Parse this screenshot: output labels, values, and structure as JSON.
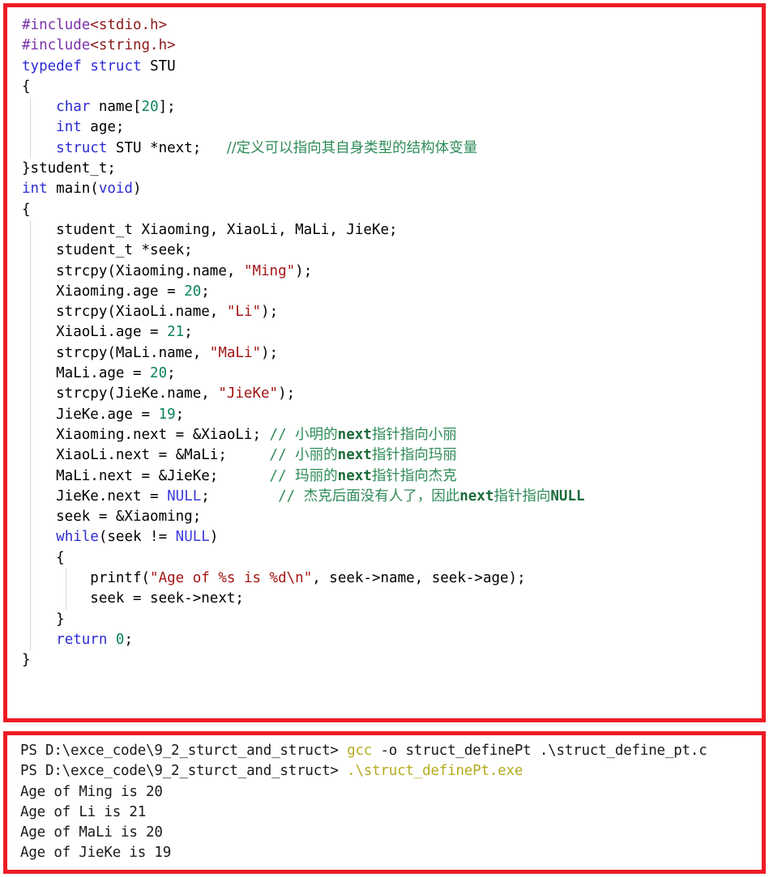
{
  "colors": {
    "border_red": "#ee1c25",
    "keyword_blue": "#2c2cd4",
    "preprocessor_purple": "#7b32a8",
    "header_darkred": "#8b1a1a",
    "string_red": "#a31515",
    "number_green": "#0b8457",
    "comment_green": "#2e8b57",
    "null_blue": "#3b3bdd",
    "terminal_command_olive": "#b5ab20",
    "background": "#ffffff",
    "text_black": "#000000"
  },
  "code_panel": {
    "language": "c",
    "lines": [
      {
        "n": 1,
        "tokens": [
          {
            "t": "#include",
            "c": "pre"
          },
          {
            "t": "<stdio.h>",
            "c": "hdr"
          }
        ]
      },
      {
        "n": 2,
        "tokens": [
          {
            "t": "#include",
            "c": "pre"
          },
          {
            "t": "<string.h>",
            "c": "hdr"
          }
        ]
      },
      {
        "n": 3,
        "tokens": [
          {
            "t": "typedef",
            "c": "kw"
          },
          {
            "t": " ",
            "c": "plain"
          },
          {
            "t": "struct",
            "c": "kw"
          },
          {
            "t": " STU",
            "c": "plain"
          }
        ]
      },
      {
        "n": 4,
        "tokens": [
          {
            "t": "{",
            "c": "plain"
          }
        ]
      },
      {
        "n": 5,
        "tokens": [
          {
            "t": "    ",
            "c": "plain"
          },
          {
            "t": "char",
            "c": "kw"
          },
          {
            "t": " name[",
            "c": "plain"
          },
          {
            "t": "20",
            "c": "num"
          },
          {
            "t": "];",
            "c": "plain"
          }
        ]
      },
      {
        "n": 6,
        "tokens": [
          {
            "t": "    ",
            "c": "plain"
          },
          {
            "t": "int",
            "c": "kw"
          },
          {
            "t": " age;",
            "c": "plain"
          }
        ]
      },
      {
        "n": 7,
        "tokens": [
          {
            "t": "    ",
            "c": "plain"
          },
          {
            "t": "struct",
            "c": "kw"
          },
          {
            "t": " STU *next;   ",
            "c": "plain"
          },
          {
            "t": "//定义可以指向其自身类型的结构体变量",
            "c": "cmtcn"
          }
        ]
      },
      {
        "n": 8,
        "tokens": [
          {
            "t": "}student_t;",
            "c": "plain"
          }
        ]
      },
      {
        "n": 9,
        "tokens": [
          {
            "t": "int",
            "c": "kw"
          },
          {
            "t": " main(",
            "c": "plain"
          },
          {
            "t": "void",
            "c": "kw"
          },
          {
            "t": ")",
            "c": "plain"
          }
        ]
      },
      {
        "n": 10,
        "tokens": [
          {
            "t": "{",
            "c": "plain"
          }
        ]
      },
      {
        "n": 11,
        "tokens": [
          {
            "t": "    student_t Xiaoming, XiaoLi, MaLi, JieKe;",
            "c": "plain"
          }
        ]
      },
      {
        "n": 12,
        "tokens": [
          {
            "t": "    student_t *seek;",
            "c": "plain"
          }
        ]
      },
      {
        "n": 13,
        "tokens": [
          {
            "t": "    strcpy(Xiaoming.name, ",
            "c": "plain"
          },
          {
            "t": "\"Ming\"",
            "c": "str"
          },
          {
            "t": ");",
            "c": "plain"
          }
        ]
      },
      {
        "n": 14,
        "tokens": [
          {
            "t": "    Xiaoming.age = ",
            "c": "plain"
          },
          {
            "t": "20",
            "c": "num"
          },
          {
            "t": ";",
            "c": "plain"
          }
        ]
      },
      {
        "n": 15,
        "tokens": [
          {
            "t": "    strcpy(XiaoLi.name, ",
            "c": "plain"
          },
          {
            "t": "\"Li\"",
            "c": "str"
          },
          {
            "t": ");",
            "c": "plain"
          }
        ]
      },
      {
        "n": 16,
        "tokens": [
          {
            "t": "    XiaoLi.age = ",
            "c": "plain"
          },
          {
            "t": "21",
            "c": "num"
          },
          {
            "t": ";",
            "c": "plain"
          }
        ]
      },
      {
        "n": 17,
        "tokens": [
          {
            "t": "    strcpy(MaLi.name, ",
            "c": "plain"
          },
          {
            "t": "\"MaLi\"",
            "c": "str"
          },
          {
            "t": ");",
            "c": "plain"
          }
        ]
      },
      {
        "n": 18,
        "tokens": [
          {
            "t": "    MaLi.age = ",
            "c": "plain"
          },
          {
            "t": "20",
            "c": "num"
          },
          {
            "t": ";",
            "c": "plain"
          }
        ]
      },
      {
        "n": 19,
        "tokens": [
          {
            "t": "    strcpy(JieKe.name, ",
            "c": "plain"
          },
          {
            "t": "\"JieKe\"",
            "c": "str"
          },
          {
            "t": ");",
            "c": "plain"
          }
        ]
      },
      {
        "n": 20,
        "tokens": [
          {
            "t": "    JieKe.age = ",
            "c": "plain"
          },
          {
            "t": "19",
            "c": "num"
          },
          {
            "t": ";",
            "c": "plain"
          }
        ]
      },
      {
        "n": 21,
        "tokens": [
          {
            "t": "    Xiaoming.next = &XiaoLi; ",
            "c": "plain"
          },
          {
            "t": "// ",
            "c": "cmt"
          },
          {
            "t": "小明的",
            "c": "cmtcn"
          },
          {
            "t": "next",
            "c": "cmtb"
          },
          {
            "t": "指针指向小丽",
            "c": "cmtcn"
          }
        ]
      },
      {
        "n": 22,
        "tokens": [
          {
            "t": "    XiaoLi.next = &MaLi;     ",
            "c": "plain"
          },
          {
            "t": "// ",
            "c": "cmt"
          },
          {
            "t": "小丽的",
            "c": "cmtcn"
          },
          {
            "t": "next",
            "c": "cmtb"
          },
          {
            "t": "指针指向玛丽",
            "c": "cmtcn"
          }
        ]
      },
      {
        "n": 23,
        "tokens": [
          {
            "t": "    MaLi.next = &JieKe;      ",
            "c": "plain"
          },
          {
            "t": "// ",
            "c": "cmt"
          },
          {
            "t": "玛丽的",
            "c": "cmtcn"
          },
          {
            "t": "next",
            "c": "cmtb"
          },
          {
            "t": "指针指向杰克",
            "c": "cmtcn"
          }
        ]
      },
      {
        "n": 24,
        "tokens": [
          {
            "t": "    JieKe.next = ",
            "c": "plain"
          },
          {
            "t": "NULL",
            "c": "nul"
          },
          {
            "t": ";        ",
            "c": "plain"
          },
          {
            "t": "// ",
            "c": "cmt"
          },
          {
            "t": "杰克后面没有人了，因此",
            "c": "cmtcn"
          },
          {
            "t": "next",
            "c": "cmtb"
          },
          {
            "t": "指针指向",
            "c": "cmtcn"
          },
          {
            "t": "NULL",
            "c": "cmtb"
          }
        ]
      },
      {
        "n": 25,
        "tokens": [
          {
            "t": "    seek = &Xiaoming;",
            "c": "plain"
          }
        ]
      },
      {
        "n": 26,
        "tokens": [
          {
            "t": "    ",
            "c": "plain"
          },
          {
            "t": "while",
            "c": "kw"
          },
          {
            "t": "(seek != ",
            "c": "plain"
          },
          {
            "t": "NULL",
            "c": "nul"
          },
          {
            "t": ")",
            "c": "plain"
          }
        ]
      },
      {
        "n": 27,
        "tokens": [
          {
            "t": "    {",
            "c": "plain"
          }
        ]
      },
      {
        "n": 28,
        "tokens": [
          {
            "t": "        printf(",
            "c": "plain"
          },
          {
            "t": "\"Age of %s is %d\\n\"",
            "c": "str"
          },
          {
            "t": ", seek->name, seek->age);",
            "c": "plain"
          }
        ]
      },
      {
        "n": 29,
        "tokens": [
          {
            "t": "        seek = seek->next;",
            "c": "plain"
          }
        ]
      },
      {
        "n": 30,
        "tokens": [
          {
            "t": "    }",
            "c": "plain"
          }
        ]
      },
      {
        "n": 31,
        "tokens": [
          {
            "t": "    ",
            "c": "plain"
          },
          {
            "t": "return",
            "c": "kw"
          },
          {
            "t": " ",
            "c": "plain"
          },
          {
            "t": "0",
            "c": "num"
          },
          {
            "t": ";",
            "c": "plain"
          }
        ]
      },
      {
        "n": 32,
        "tokens": [
          {
            "t": "}",
            "c": "plain"
          }
        ]
      }
    ]
  },
  "terminal_panel": {
    "shell": "PowerShell",
    "prompt": "PS D:\\exce_code\\9_2_sturct_and_struct>",
    "lines": [
      {
        "type": "command",
        "prompt": "PS D:\\exce_code\\9_2_sturct_and_struct>",
        "command": "gcc",
        "args": " -o struct_definePt .\\struct_define_pt.c"
      },
      {
        "type": "command",
        "prompt": "PS D:\\exce_code\\9_2_sturct_and_struct>",
        "command": ".\\struct_definePt.exe",
        "args": ""
      },
      {
        "type": "output",
        "text": "Age of Ming is 20"
      },
      {
        "type": "output",
        "text": "Age of Li is 21"
      },
      {
        "type": "output",
        "text": "Age of MaLi is 20"
      },
      {
        "type": "output",
        "text": "Age of JieKe is 19"
      }
    ]
  }
}
